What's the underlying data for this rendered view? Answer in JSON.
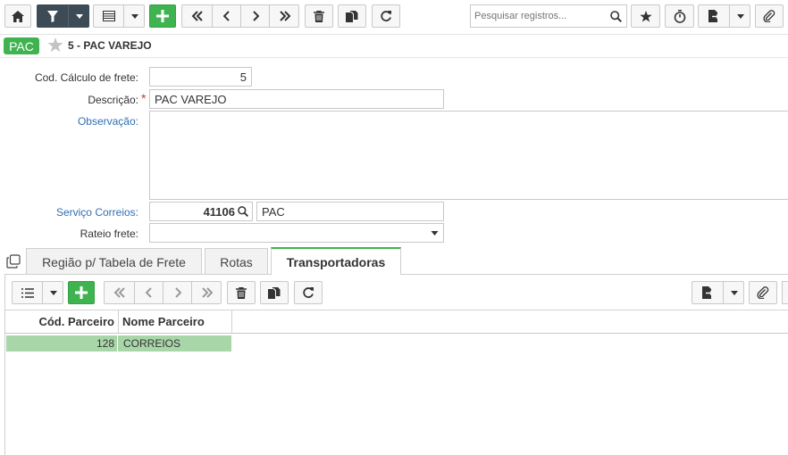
{
  "toolbar": {
    "search_placeholder": "Pesquisar registros..."
  },
  "record": {
    "badge": "PAC",
    "title": "5 - PAC VAREJO"
  },
  "form": {
    "cod_label": "Cod. Cálculo de frete:",
    "cod_value": "5",
    "descricao_label": "Descrição:",
    "descricao_value": "PAC VAREJO",
    "required_mark": "*",
    "observacao_label": "Observação:",
    "observacao_value": "",
    "servico_label": "Serviço Correios:",
    "servico_code": "41106",
    "servico_name": "PAC",
    "rateio_label": "Rateio frete:",
    "rateio_value": ""
  },
  "tabs": [
    {
      "label": "Região p/ Tabela de Frete"
    },
    {
      "label": "Rotas"
    },
    {
      "label": "Transportadoras"
    }
  ],
  "grid": {
    "columns": [
      "Cód. Parceiro",
      "Nome Parceiro"
    ],
    "rows": [
      {
        "cod": "128",
        "nome": "CORREIOS"
      }
    ]
  },
  "colors": {
    "accent_green": "#3fb34f",
    "dark_button": "#3d4b57",
    "link_blue": "#2f6eb5",
    "row_selected": "#a9d6a9"
  },
  "icons": [
    "home-icon",
    "filter-icon",
    "grid-view-icon",
    "add-icon",
    "first-icon",
    "prev-icon",
    "next-icon",
    "last-icon",
    "trash-icon",
    "copy-icon",
    "refresh-icon",
    "search-icon",
    "star-icon",
    "timer-icon",
    "export-icon",
    "attach-icon",
    "window-icon",
    "list-icon",
    "caret-down-icon"
  ]
}
